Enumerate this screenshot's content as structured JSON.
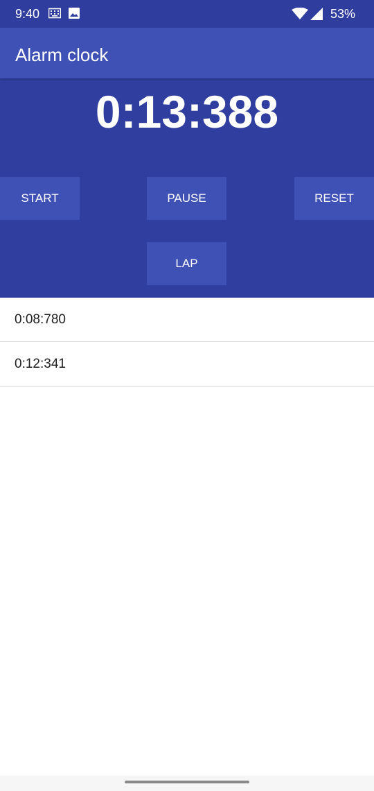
{
  "status_bar": {
    "time": "9:40",
    "battery": "53%",
    "icons": [
      "keyboard-icon",
      "image-icon",
      "wifi-icon",
      "signal-icon"
    ]
  },
  "app_bar": {
    "title": "Alarm clock",
    "color": "#3f51b5"
  },
  "timer": {
    "display": "0:13:388",
    "panel_color": "#303f9f"
  },
  "controls": {
    "start": "START",
    "pause": "PAUSE",
    "reset": "RESET",
    "lap": "LAP"
  },
  "laps": [
    {
      "time": "0:08:780"
    },
    {
      "time": "0:12:341"
    }
  ]
}
